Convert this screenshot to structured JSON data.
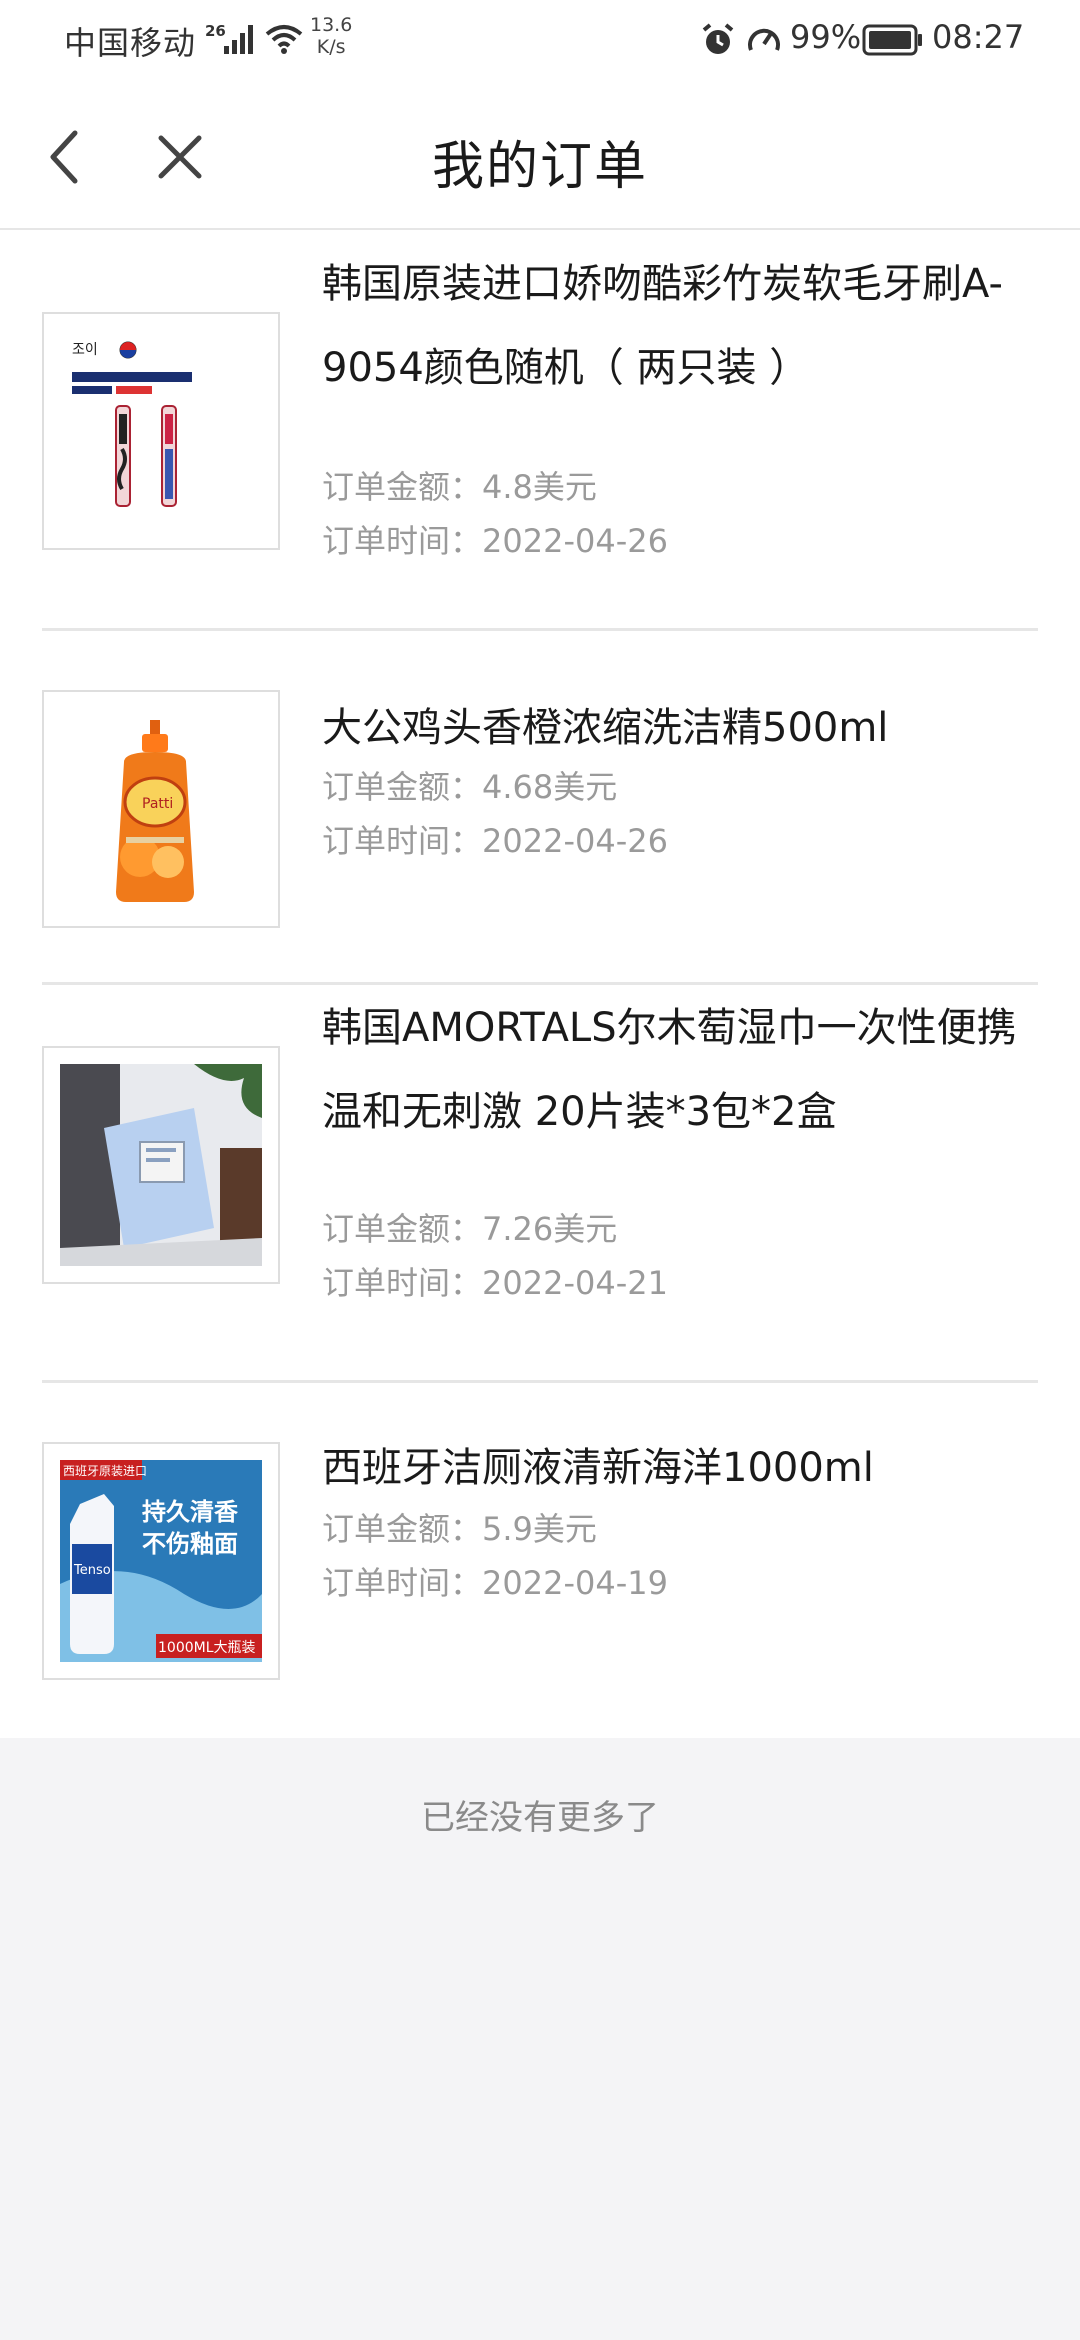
{
  "status_bar": {
    "carrier": "中国移动",
    "network": "26",
    "speed_value": "13.6",
    "speed_unit": "K/s",
    "battery_percent": "99%",
    "time": "08:27"
  },
  "header": {
    "title": "我的订单",
    "back_icon": "chevron-left-icon",
    "close_icon": "close-icon"
  },
  "order_labels": {
    "amount_label": "订单金额：",
    "time_label": "订单时间："
  },
  "orders": [
    {
      "name": "韩国原装进口娇吻酷彩竹炭软毛牙刷A-9054颜色随机（ 两只装 ）",
      "amount": "4.8美元",
      "date": "2022-04-26"
    },
    {
      "name": "大公鸡头香橙浓缩洗洁精500ml",
      "amount": "4.68美元",
      "date": "2022-04-26"
    },
    {
      "name": "韩国AMORTALS尔木萄湿巾一次性便携温和无刺激 20片装*3包*2盒",
      "amount": "7.26美元",
      "date": "2022-04-21"
    },
    {
      "name": "西班牙洁厕液清新海洋1000ml",
      "amount": "5.9美元",
      "date": "2022-04-19"
    }
  ],
  "product_images": {
    "toothbrush_brand": "조이",
    "detergent_brand": "Patti",
    "toilet_banner": "西班牙原装进口",
    "toilet_slogan1": "持久清香",
    "toilet_slogan2": "不伤釉面",
    "toilet_brand": "Tenso",
    "toilet_size": "1000ML大瓶装"
  },
  "footer": {
    "no_more": "已经没有更多了"
  },
  "colors": {
    "page_bg": "#f4f4f6",
    "card_bg": "#ffffff",
    "meta_text": "#9a9a9a",
    "divider": "#e6e6e6"
  }
}
